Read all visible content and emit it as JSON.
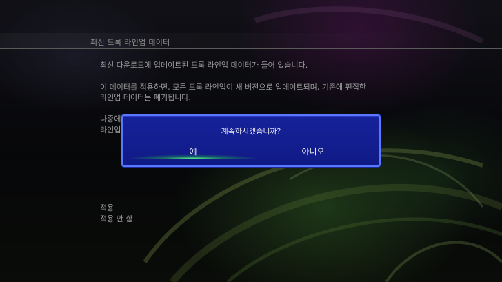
{
  "screen": {
    "title": "최신 드록 라인업 데이터"
  },
  "body": {
    "line1": "최신 다운로드에 업데이트된 드록 라인업 데이터가 들어 있습니다.",
    "line2": "이 데이터를 적용하면, 모든 드록 라인업이 새 버전으로 업데이트되며, 기존에 편집한",
    "line3": "라인업 데이터는 폐기됩니다.",
    "line4": "나중에",
    "line5": "라인업"
  },
  "options": {
    "apply": "적용",
    "not_apply": "적용 안 함"
  },
  "dialog": {
    "question": "계속하시겠습니까?",
    "yes": "예",
    "no": "아니오",
    "selected": "yes"
  },
  "colors": {
    "dialog_bg": "#14209a",
    "dialog_border": "#5a78ff",
    "highlight": "#5aff8c"
  }
}
